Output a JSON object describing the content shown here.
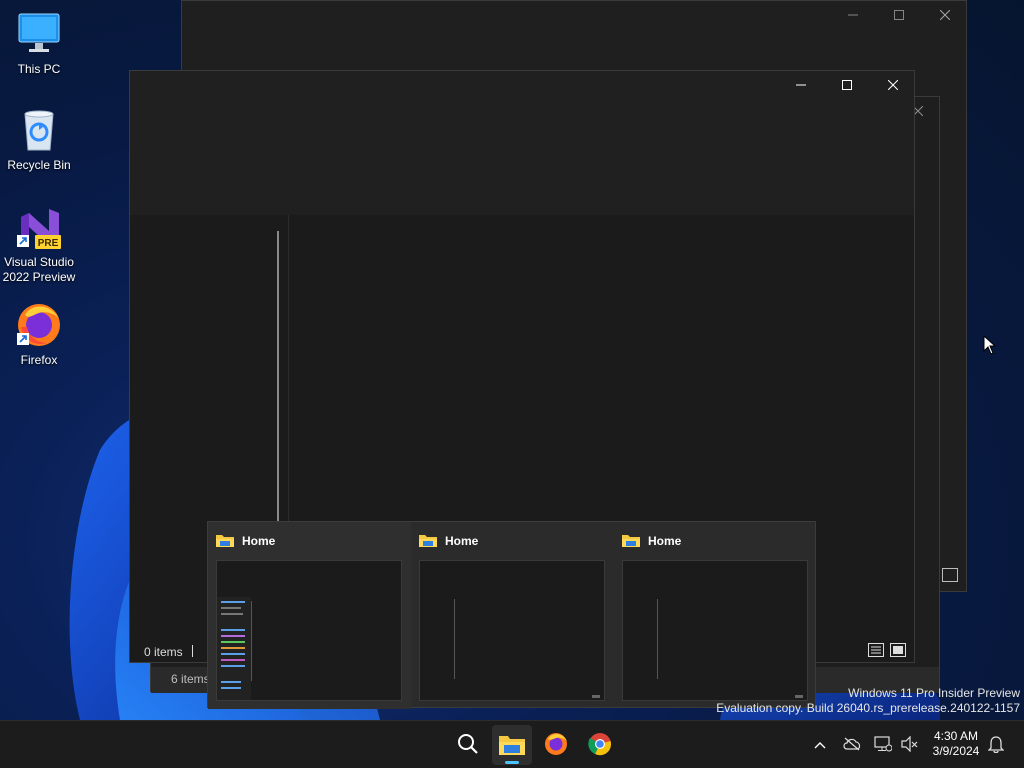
{
  "desktop": {
    "icons": [
      {
        "label": "This PC",
        "icon": "monitor-icon"
      },
      {
        "label": "Recycle Bin",
        "icon": "recycle-bin-icon"
      },
      {
        "label": "Visual Studio 2022 Preview",
        "icon": "visual-studio-preview-icon",
        "badge": "PRE"
      },
      {
        "label": "Firefox",
        "icon": "firefox-icon"
      }
    ]
  },
  "windows": {
    "front": {
      "status_items": "0 items",
      "caption": {
        "minimize": "minimize-icon",
        "maximize": "maximize-icon",
        "close": "close-icon"
      }
    },
    "middle": {
      "status_items": "6 items"
    }
  },
  "thumbnails": [
    {
      "title": "Home",
      "icon": "folder-icon"
    },
    {
      "title": "Home",
      "icon": "folder-icon"
    },
    {
      "title": "Home",
      "icon": "folder-icon"
    }
  ],
  "watermark": {
    "line1": "Windows 11 Pro Insider Preview",
    "line2": "Evaluation copy. Build 26040.rs_prerelease.240122-1157"
  },
  "taskbar": {
    "apps": [
      {
        "name": "Search",
        "icon": "search-icon"
      },
      {
        "name": "File Explorer",
        "icon": "file-explorer-icon",
        "active": true
      },
      {
        "name": "Firefox",
        "icon": "firefox-icon"
      },
      {
        "name": "Chrome",
        "icon": "chrome-icon"
      }
    ],
    "tray": {
      "time": "4:30 AM",
      "date": "3/9/2024",
      "icons": [
        "chevron-up-icon",
        "onedrive-icon",
        "network-icon",
        "volume-muted-icon",
        "notification-bell-icon"
      ]
    }
  },
  "colors": {
    "accent": "#4cc2ff",
    "window_bg": "#202020",
    "taskbar_bg": "#1c1c1c"
  }
}
